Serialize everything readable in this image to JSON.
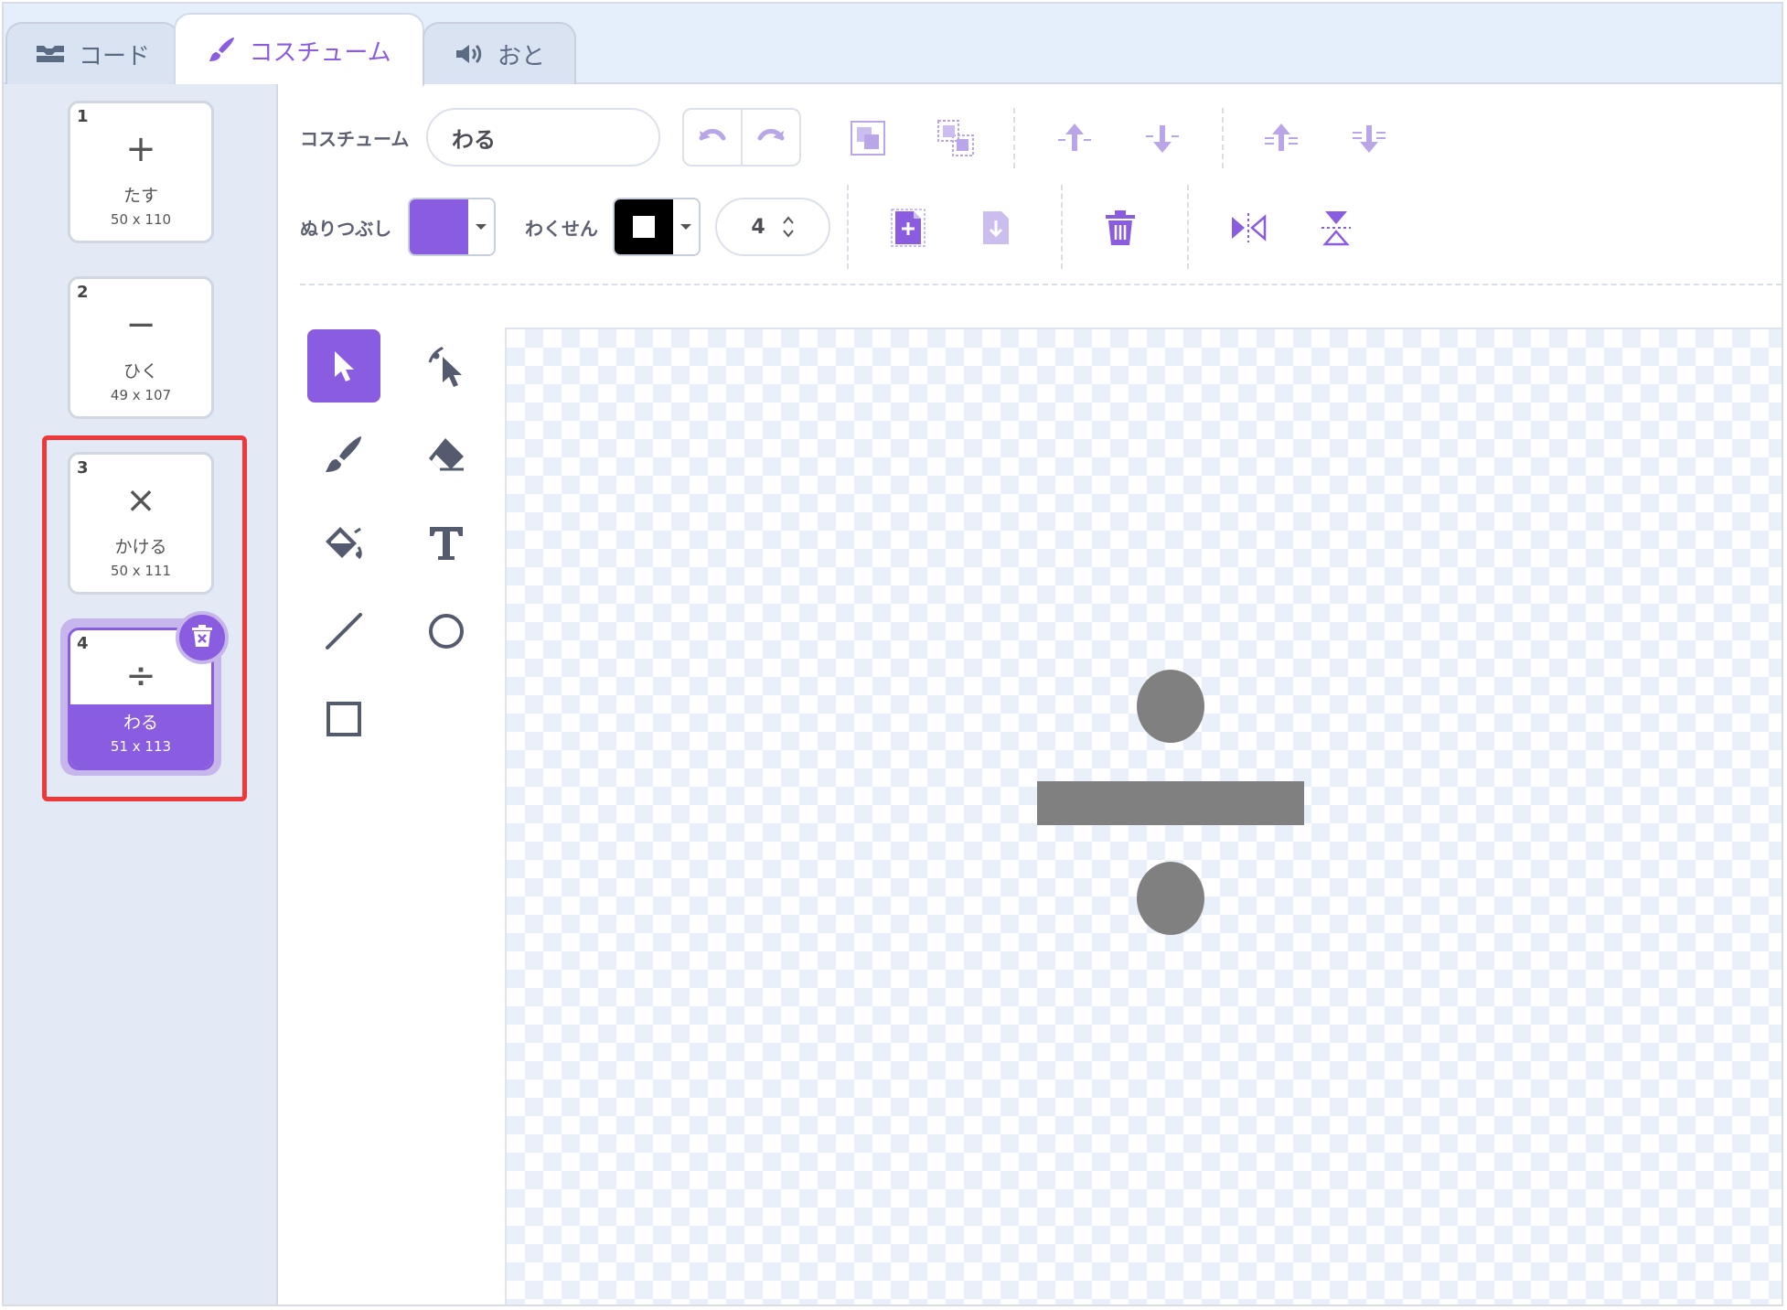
{
  "tabs": [
    {
      "label": "コード",
      "icon": "code-blocks-icon",
      "active": false
    },
    {
      "label": "コスチューム",
      "icon": "paintbrush-icon",
      "active": true
    },
    {
      "label": "おと",
      "icon": "speaker-icon",
      "active": false
    }
  ],
  "costumes": [
    {
      "number": "1",
      "glyph": "+",
      "name": "たす",
      "size": "50 x 110"
    },
    {
      "number": "2",
      "glyph": "−",
      "name": "ひく",
      "size": "49 x 107"
    },
    {
      "number": "3",
      "glyph": "×",
      "name": "かける",
      "size": "50 x 111"
    },
    {
      "number": "4",
      "glyph": "÷",
      "name": "わる",
      "size": "51 x 113",
      "selected": true
    }
  ],
  "toolbar": {
    "costume_label": "コスチューム",
    "costume_name": "わる",
    "fill_label": "ぬりつぶし",
    "outline_label": "わくせん",
    "stroke_width": "4"
  },
  "colors": {
    "accent": "#8a5ce0",
    "fill": "#8a5ce0",
    "outline": "#000000",
    "highlight_box": "#f0383a",
    "shape": "#808080"
  },
  "tools": [
    "select-arrow-icon",
    "reshape-icon",
    "brush-icon",
    "eraser-icon",
    "fill-bucket-icon",
    "text-icon",
    "line-icon",
    "circle-icon",
    "rectangle-icon"
  ]
}
